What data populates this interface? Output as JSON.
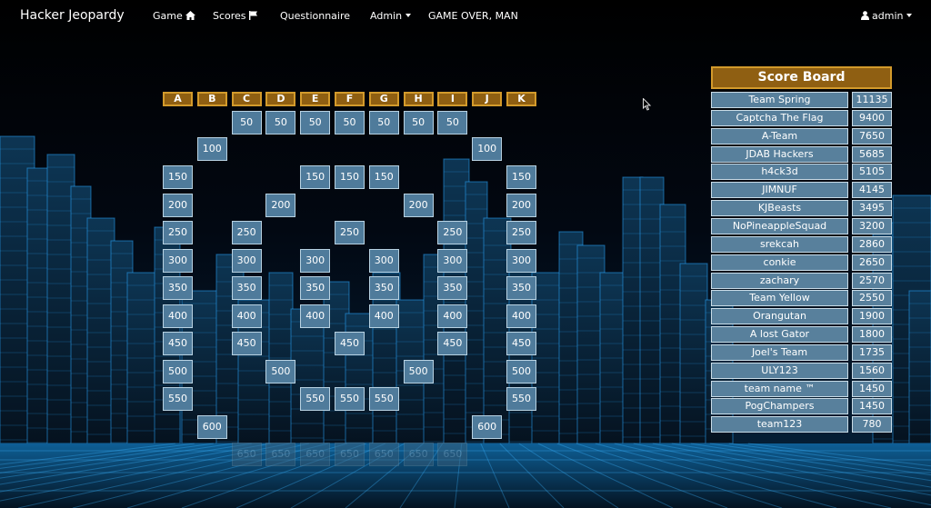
{
  "navbar": {
    "brand": "Hacker Jeopardy",
    "game": "Game",
    "scores": "Scores",
    "questionnaire": "Questionnaire",
    "admin": "Admin",
    "game_over": "GAME OVER, MAN",
    "user": "admin",
    "icons": {
      "game": "home-icon",
      "scores": "flag-icon",
      "user": "user-icon"
    }
  },
  "board": {
    "categories": [
      "A",
      "B",
      "C",
      "D",
      "E",
      "F",
      "G",
      "H",
      "I",
      "J",
      "K"
    ],
    "tiles": [
      {
        "cat": "C",
        "value": "50"
      },
      {
        "cat": "D",
        "value": "50"
      },
      {
        "cat": "E",
        "value": "50"
      },
      {
        "cat": "F",
        "value": "50"
      },
      {
        "cat": "G",
        "value": "50"
      },
      {
        "cat": "H",
        "value": "50"
      },
      {
        "cat": "I",
        "value": "50"
      },
      {
        "cat": "B",
        "value": "100"
      },
      {
        "cat": "J",
        "value": "100"
      },
      {
        "cat": "A",
        "value": "150"
      },
      {
        "cat": "E",
        "value": "150"
      },
      {
        "cat": "F",
        "value": "150"
      },
      {
        "cat": "G",
        "value": "150"
      },
      {
        "cat": "K",
        "value": "150"
      },
      {
        "cat": "A",
        "value": "200"
      },
      {
        "cat": "D",
        "value": "200"
      },
      {
        "cat": "H",
        "value": "200"
      },
      {
        "cat": "K",
        "value": "200"
      },
      {
        "cat": "A",
        "value": "250"
      },
      {
        "cat": "C",
        "value": "250"
      },
      {
        "cat": "F",
        "value": "250"
      },
      {
        "cat": "I",
        "value": "250"
      },
      {
        "cat": "K",
        "value": "250"
      },
      {
        "cat": "A",
        "value": "300"
      },
      {
        "cat": "C",
        "value": "300"
      },
      {
        "cat": "E",
        "value": "300"
      },
      {
        "cat": "G",
        "value": "300"
      },
      {
        "cat": "I",
        "value": "300"
      },
      {
        "cat": "K",
        "value": "300"
      },
      {
        "cat": "A",
        "value": "350"
      },
      {
        "cat": "C",
        "value": "350"
      },
      {
        "cat": "E",
        "value": "350"
      },
      {
        "cat": "G",
        "value": "350"
      },
      {
        "cat": "I",
        "value": "350"
      },
      {
        "cat": "K",
        "value": "350"
      },
      {
        "cat": "A",
        "value": "400"
      },
      {
        "cat": "C",
        "value": "400"
      },
      {
        "cat": "E",
        "value": "400"
      },
      {
        "cat": "G",
        "value": "400"
      },
      {
        "cat": "I",
        "value": "400"
      },
      {
        "cat": "K",
        "value": "400"
      },
      {
        "cat": "A",
        "value": "450"
      },
      {
        "cat": "C",
        "value": "450"
      },
      {
        "cat": "F",
        "value": "450"
      },
      {
        "cat": "I",
        "value": "450"
      },
      {
        "cat": "K",
        "value": "450"
      },
      {
        "cat": "A",
        "value": "500"
      },
      {
        "cat": "D",
        "value": "500"
      },
      {
        "cat": "H",
        "value": "500"
      },
      {
        "cat": "K",
        "value": "500"
      },
      {
        "cat": "A",
        "value": "550"
      },
      {
        "cat": "E",
        "value": "550"
      },
      {
        "cat": "F",
        "value": "550"
      },
      {
        "cat": "G",
        "value": "550"
      },
      {
        "cat": "K",
        "value": "550"
      },
      {
        "cat": "B",
        "value": "600"
      },
      {
        "cat": "J",
        "value": "600"
      },
      {
        "cat": "C",
        "value": "650",
        "used": true
      },
      {
        "cat": "D",
        "value": "650",
        "used": true
      },
      {
        "cat": "E",
        "value": "650",
        "used": true
      },
      {
        "cat": "F",
        "value": "650",
        "used": true
      },
      {
        "cat": "G",
        "value": "650",
        "used": true
      },
      {
        "cat": "H",
        "value": "650",
        "used": true
      },
      {
        "cat": "I",
        "value": "650",
        "used": true
      }
    ]
  },
  "scoreboard": {
    "title": "Score Board",
    "teams": [
      {
        "name": "Team Spring",
        "score": "11135"
      },
      {
        "name": "Captcha The Flag",
        "score": "9400"
      },
      {
        "name": "A-Team",
        "score": "7650"
      },
      {
        "name": "JDAB Hackers",
        "score": "5685"
      },
      {
        "name": "h4ck3d",
        "score": "5105"
      },
      {
        "name": "JIMNUF",
        "score": "4145"
      },
      {
        "name": "KJBeasts",
        "score": "3495"
      },
      {
        "name": "NoPineappleSquad",
        "score": "3200"
      },
      {
        "name": "srekcah",
        "score": "2860"
      },
      {
        "name": "conkie",
        "score": "2650"
      },
      {
        "name": "zachary",
        "score": "2570"
      },
      {
        "name": "Team Yellow",
        "score": "2550"
      },
      {
        "name": "Orangutan",
        "score": "1900"
      },
      {
        "name": "A lost Gator",
        "score": "1800"
      },
      {
        "name": "Joel's Team",
        "score": "1735"
      },
      {
        "name": "ULY123",
        "score": "1560"
      },
      {
        "name": "team name ™",
        "score": "1450"
      },
      {
        "name": "PogChampers",
        "score": "1450"
      },
      {
        "name": "team123",
        "score": "780"
      }
    ]
  },
  "colors": {
    "category_fill": "#8f5f12",
    "category_border": "#d39a2b",
    "tile_fill": "#4f7b9b",
    "tile_border": "#b8d2e2",
    "glow": "#2aa8ff"
  }
}
